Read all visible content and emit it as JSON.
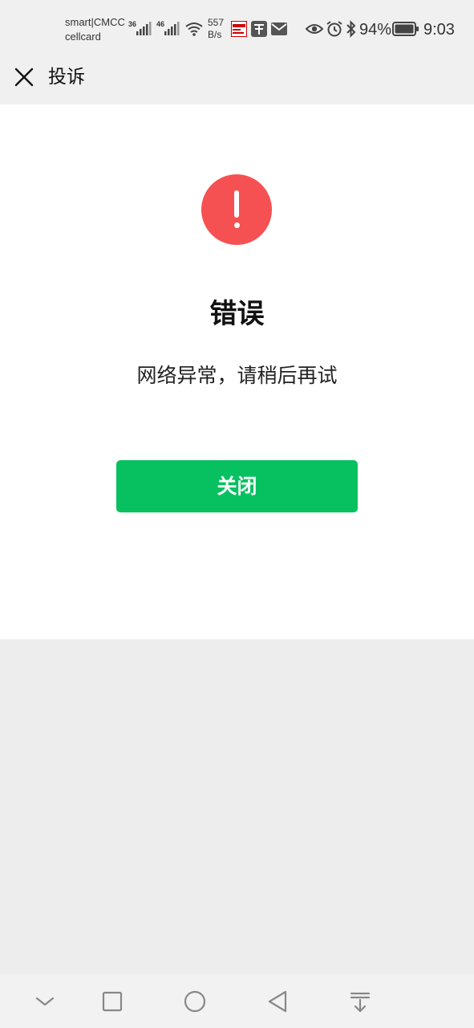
{
  "status_bar": {
    "carrier_line1": "smart|CMCC",
    "carrier_line2": "cellcard",
    "signal1_label": "36",
    "signal2_label": "46",
    "speed_value": "557",
    "speed_unit": "B/s",
    "battery_percent": "94%",
    "time": "9:03"
  },
  "navbar": {
    "title": "投诉"
  },
  "error": {
    "title": "错误",
    "message": "网络异常，请稍后再试",
    "close_button": "关闭"
  },
  "colors": {
    "error_red": "#f55153",
    "button_green": "#07c160"
  }
}
